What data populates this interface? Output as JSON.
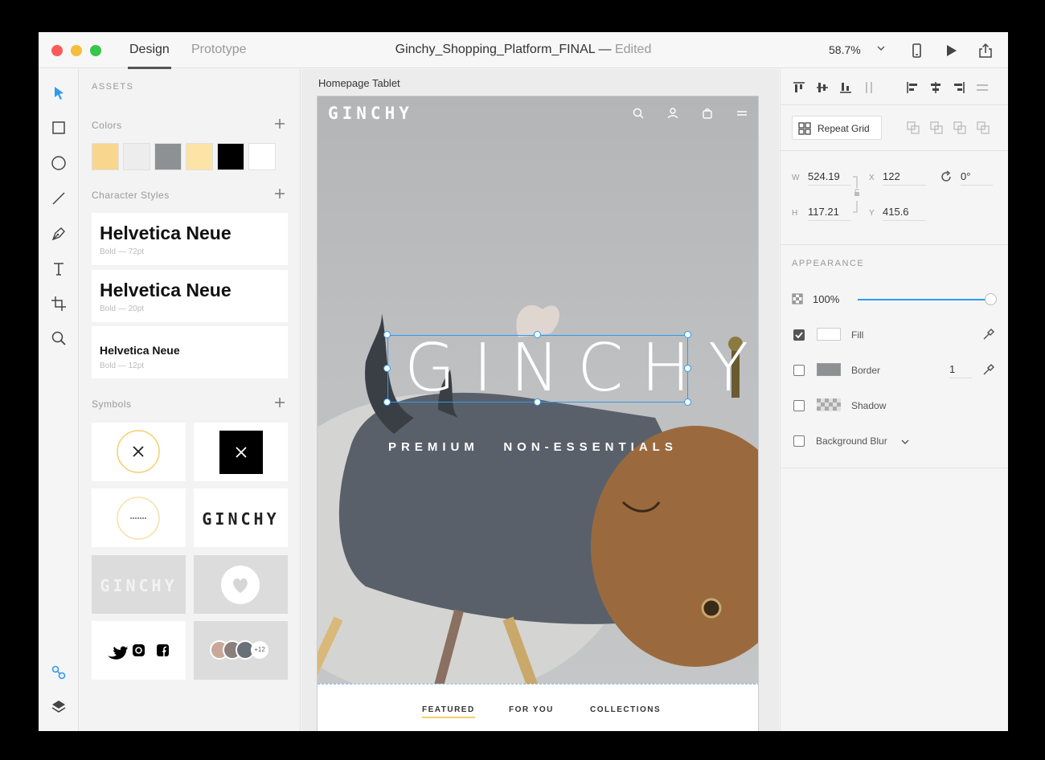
{
  "titlebar": {
    "tabs": [
      "Design",
      "Prototype"
    ],
    "doc_name": "Ginchy_Shopping_Platform_FINAL",
    "separator": "—",
    "status": "Edited",
    "zoom": "58.7%"
  },
  "assets": {
    "heading": "ASSETS",
    "colors_label": "Colors",
    "colors": [
      "#f8d68e",
      "#ededed",
      "#8e9193",
      "#fce3a6",
      "#000000",
      "#ffffff"
    ],
    "char_styles_label": "Character Styles",
    "char_styles": [
      {
        "name": "Helvetica Neue",
        "meta": "Bold — 72pt"
      },
      {
        "name": "Helvetica Neue",
        "meta": "Bold — 20pt"
      },
      {
        "name": "Helvetica Neue",
        "meta": "Bold — 12pt"
      }
    ],
    "symbols_label": "Symbols",
    "symbol_logo_text": "GINCHY",
    "avatar_count": "+12"
  },
  "canvas": {
    "artboard_name": "Homepage Tablet",
    "logo": "GINCHY",
    "hero_title": "GINCHY",
    "hero_subtitle": "PREMIUM   NON-ESSENTIALS",
    "nav": [
      "FEATURED",
      "FOR YOU",
      "COLLECTIONS"
    ]
  },
  "properties": {
    "repeat_grid_label": "Repeat Grid",
    "w_label": "W",
    "w": "524.19",
    "h_label": "H",
    "h": "117.21",
    "x_label": "X",
    "x": "122",
    "y_label": "Y",
    "y": "415.6",
    "rotation": "0°",
    "appearance_label": "APPEARANCE",
    "opacity": "100%",
    "opacity_fraction": 1.0,
    "fill_label": "Fill",
    "border_label": "Border",
    "border_width": "1",
    "shadow_label": "Shadow",
    "bg_blur_label": "Background Blur",
    "accent": "#2d9cf0"
  }
}
